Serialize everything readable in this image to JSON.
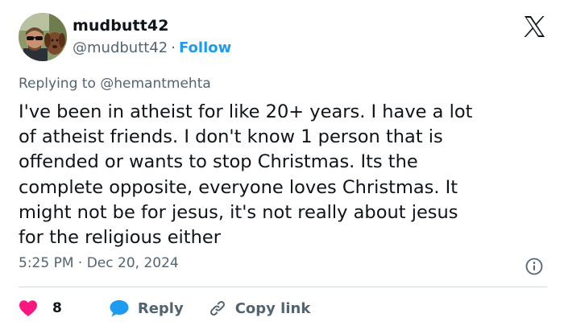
{
  "user": {
    "display_name": "mudbutt42",
    "handle": "@mudbutt42",
    "separator": "·",
    "follow_label": "Follow"
  },
  "reply_context": {
    "prefix": "Replying to ",
    "mention": "@hemantmehta"
  },
  "tweet": {
    "text": "I've been in atheist for like 20+ years. I have a lot\nof atheist friends. I don't know 1 person that is\noffended or wants to stop Christmas. Its the\ncomplete opposite, everyone loves Christmas. It\nmight not be for jesus, it's not really about jesus\nfor the religious either"
  },
  "meta": {
    "time": "5:25 PM",
    "separator": "·",
    "date": "Dec 20, 2024"
  },
  "actions": {
    "like_count": "8",
    "reply_label": "Reply",
    "copy_label": "Copy link"
  },
  "icons": {
    "logo": "x-logo-icon",
    "info": "info-icon",
    "like": "heart-icon",
    "reply": "speech-bubble-icon",
    "copy": "link-icon"
  },
  "colors": {
    "accent": "#1d9bf0",
    "like": "#f91880",
    "secondary_text": "#536471",
    "divider": "#cfd9de"
  }
}
